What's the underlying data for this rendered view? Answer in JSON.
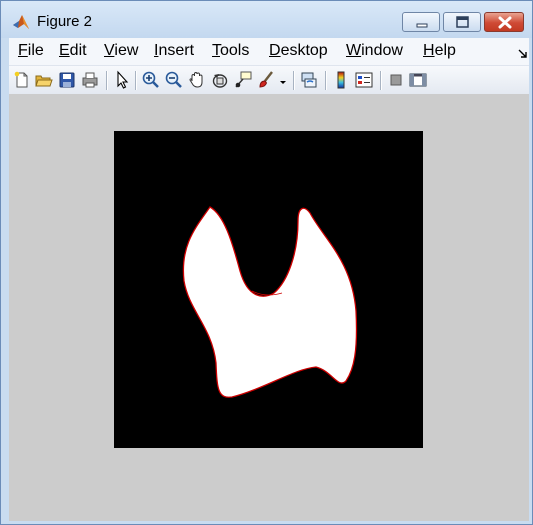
{
  "window": {
    "title": "Figure 2",
    "icon": "matlab-icon",
    "controls": [
      "minimize-icon",
      "maximize-icon",
      "close-icon"
    ]
  },
  "menubar": {
    "items": [
      {
        "label": "File",
        "mnemonic": "F",
        "rest": "ile"
      },
      {
        "label": "Edit",
        "mnemonic": "E",
        "rest": "dit"
      },
      {
        "label": "View",
        "mnemonic": "V",
        "rest": "iew"
      },
      {
        "label": "Insert",
        "mnemonic": "I",
        "rest": "nsert"
      },
      {
        "label": "Tools",
        "mnemonic": "T",
        "rest": "ools"
      },
      {
        "label": "Desktop",
        "mnemonic": "D",
        "rest": "esktop"
      },
      {
        "label": "Window",
        "mnemonic": "W",
        "rest": "indow"
      },
      {
        "label": "Help",
        "mnemonic": "H",
        "rest": "elp"
      }
    ]
  },
  "toolbar": {
    "icons": [
      "new-figure-icon",
      "open-file-icon",
      "save-figure-icon",
      "print-figure-icon",
      "edit-plot-icon",
      "zoom-in-icon",
      "zoom-out-icon",
      "pan-icon",
      "rotate-3d-icon",
      "data-cursor-icon",
      "brush-icon",
      "link-plot-icon",
      "insert-colorbar-icon",
      "insert-legend-icon",
      "hide-plot-tools-icon",
      "show-plot-tools-icon"
    ]
  },
  "figure": {
    "background_color": "#cccccc",
    "image_background": "#000000",
    "shape_fill": "#ffffff",
    "contour_color": "#cc0000"
  }
}
